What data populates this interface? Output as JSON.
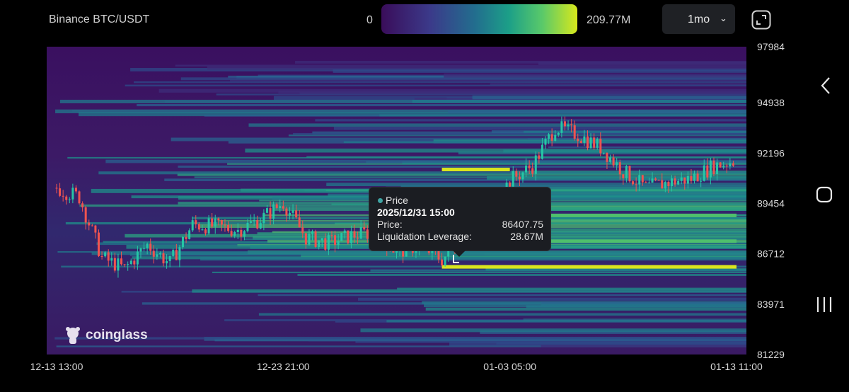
{
  "header": {
    "pair_label": "Binance BTC/USDT",
    "scale_min": "0",
    "scale_max": "209.77M",
    "period": "1mo"
  },
  "tooltip": {
    "title": "Price",
    "date": "2025/12/31 15:00",
    "price_label": "Price:",
    "price_value": "86407.75",
    "lev_label": "Liquidation Leverage:",
    "lev_value": "28.67M"
  },
  "brand": {
    "name": "coinglass"
  },
  "chart_data": {
    "type": "heatmap",
    "title": "",
    "xlabel": "",
    "ylabel": "",
    "y_ticks": [
      "97984",
      "94938",
      "92196",
      "89454",
      "86712",
      "83971",
      "81229"
    ],
    "x_ticks": [
      "12-13 13:00",
      "12-23 21:00",
      "01-03 05:00",
      "01-13 11:00"
    ],
    "ylim": [
      81229,
      97984
    ],
    "colorbar_range": [
      0,
      209.77
    ],
    "colorbar_unit": "M",
    "price_series": {
      "name": "Price",
      "x": [
        "12-13 13:00",
        "12-14 12:00",
        "12-15 12:00",
        "12-16 12:00",
        "12-17 12:00",
        "12-18 12:00",
        "12-19 12:00",
        "12-20 12:00",
        "12-21 12:00",
        "12-22 12:00",
        "12-23 21:00",
        "12-25 00:00",
        "12-26 00:00",
        "12-27 00:00",
        "12-28 00:00",
        "12-29 00:00",
        "12-30 00:00",
        "12-31 15:00",
        "01-01 00:00",
        "01-02 00:00",
        "01-03 05:00",
        "01-04 00:00",
        "01-05 00:00",
        "01-06 00:00",
        "01-07 00:00",
        "01-08 00:00",
        "01-09 00:00",
        "01-10 00:00",
        "01-11 00:00",
        "01-12 00:00",
        "01-13 11:00"
      ],
      "y": [
        90300,
        89800,
        86500,
        85900,
        87200,
        86200,
        88300,
        88200,
        88000,
        88600,
        89500,
        87600,
        87300,
        87700,
        87900,
        86800,
        87200,
        86408,
        87600,
        88900,
        90700,
        91500,
        93600,
        93200,
        92500,
        91200,
        90300,
        90600,
        90800,
        91500,
        91800
      ]
    },
    "liquidation_bands": [
      {
        "price": 91300,
        "x_start": "12-31 15:00",
        "x_end": "01-03 05:00",
        "intensity": "yellow"
      },
      {
        "price": 86000,
        "x_start": "12-31 15:00",
        "x_end": "01-13 11:00",
        "intensity": "yellow"
      },
      {
        "price": 88800,
        "x_start": "12-28 00:00",
        "x_end": "01-13 11:00",
        "intensity": "green"
      },
      {
        "price": 87400,
        "x_start": "12-28 00:00",
        "x_end": "01-13 11:00",
        "intensity": "green"
      }
    ]
  }
}
